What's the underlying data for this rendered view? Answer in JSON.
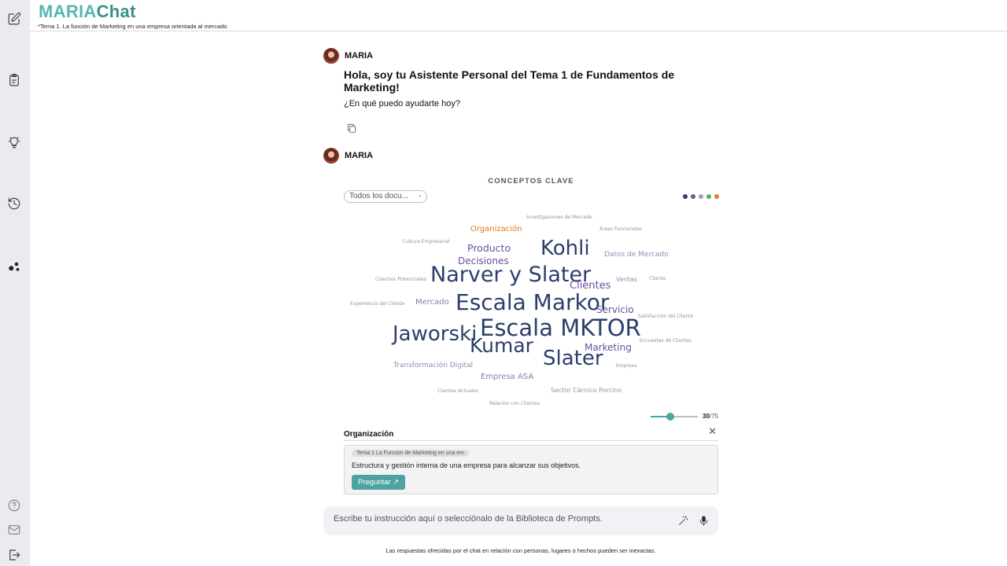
{
  "app": {
    "logo_part1": "MARIA",
    "logo_part2": "Chat",
    "subtitle": "*Tema 1. La función de Marketing en una empresa orientada al mercado"
  },
  "sidebar": {
    "icons": [
      "edit-icon",
      "document-icon",
      "lightbulb-icon",
      "history-icon",
      "network-icon",
      "help-icon",
      "mail-icon",
      "logout-icon"
    ]
  },
  "messages": [
    {
      "author": "MARIA",
      "title": "Hola, soy tu Asistente Personal del Tema 1 de Fundamentos de Marketing!",
      "text": "¿En qué puedo ayudarte hoy?"
    },
    {
      "author": "MARIA"
    }
  ],
  "concepts": {
    "title": "CONCEPTOS CLAVE",
    "doc_filter": "Todos los docu...",
    "palette": [
      "#2c3e6b",
      "#6a5aa0",
      "#9aa3bd",
      "#5aaa6e",
      "#e07b3a"
    ],
    "words": [
      {
        "text": "Investigaciones de Mercado",
        "size": 6,
        "color": "#8a93ad"
      },
      {
        "text": "Organización",
        "size": 10,
        "color": "#e07b20"
      },
      {
        "text": "Áreas Funcionales",
        "size": 6,
        "color": "#8a93ad"
      },
      {
        "text": "Cultura Empresarial",
        "size": 6,
        "color": "#8a93ad"
      },
      {
        "text": "Producto",
        "size": 12.5,
        "color": "#6a4ea0"
      },
      {
        "text": "Kohli",
        "size": 26,
        "color": "#2c3e6b"
      },
      {
        "text": "Datos de Mercado",
        "size": 9,
        "color": "#8a93ad"
      },
      {
        "text": "Decisiones",
        "size": 12,
        "color": "#6a4ea0"
      },
      {
        "text": "Clientes Potenciales",
        "size": 6.5,
        "color": "#8a93ad"
      },
      {
        "text": "Narver y Slater",
        "size": 27,
        "color": "#2c3e6b"
      },
      {
        "text": "Clientes",
        "size": 13,
        "color": "#6a4ea0"
      },
      {
        "text": "Ventas",
        "size": 8,
        "color": "#8a93ad"
      },
      {
        "text": "Cliente",
        "size": 6,
        "color": "#8a93ad"
      },
      {
        "text": "Experiencia del Cliente",
        "size": 6,
        "color": "#8a93ad"
      },
      {
        "text": "Mercado",
        "size": 10,
        "color": "#7a84a4"
      },
      {
        "text": "Escala Markor",
        "size": 28,
        "color": "#2c3e6b"
      },
      {
        "text": "Servicio",
        "size": 12,
        "color": "#6a4ea0"
      },
      {
        "text": "Satisfacción del Cliente",
        "size": 6,
        "color": "#8a93ad"
      },
      {
        "text": "Jaworski",
        "size": 26,
        "color": "#2c3e6b"
      },
      {
        "text": "Escala MKTOR",
        "size": 29,
        "color": "#2c3e6b"
      },
      {
        "text": "Encuestas de Clientes",
        "size": 6,
        "color": "#8a93ad"
      },
      {
        "text": "Kumar",
        "size": 25,
        "color": "#2c3e6b"
      },
      {
        "text": "Marketing",
        "size": 12,
        "color": "#6a4ea0"
      },
      {
        "text": "Slater",
        "size": 26,
        "color": "#2c3e6b"
      },
      {
        "text": "Transformación Digital",
        "size": 9,
        "color": "#8a93ad"
      },
      {
        "text": "Empresa",
        "size": 6,
        "color": "#8a93ad"
      },
      {
        "text": "Empresa ASA",
        "size": 10,
        "color": "#7a84a4"
      },
      {
        "text": "Clientes Actuales",
        "size": 6,
        "color": "#8a93ad"
      },
      {
        "text": "Sector Cárnico Porcino",
        "size": 8,
        "color": "#8a93ad"
      },
      {
        "text": "Relación con Clientes",
        "size": 6,
        "color": "#8a93ad"
      }
    ],
    "shown": "30",
    "total": "/75",
    "slider_fraction": 0.4
  },
  "detail": {
    "title": "Organización",
    "doc_tag": "Tema 1 La Funcion de Marketing en una em",
    "description": "Estructura y gestión interna de una empresa para alcanzar sus objetivos.",
    "ask_label": "Preguntar ↗"
  },
  "input": {
    "placeholder": "Escribe tu instrucción aquí o selecciónalo de la Biblioteca de Prompts."
  },
  "footer": {
    "disclaimer": "Las respuestas ofrecidas por el chat en relación con personas, lugares o hechos pueden ser inexactas."
  }
}
